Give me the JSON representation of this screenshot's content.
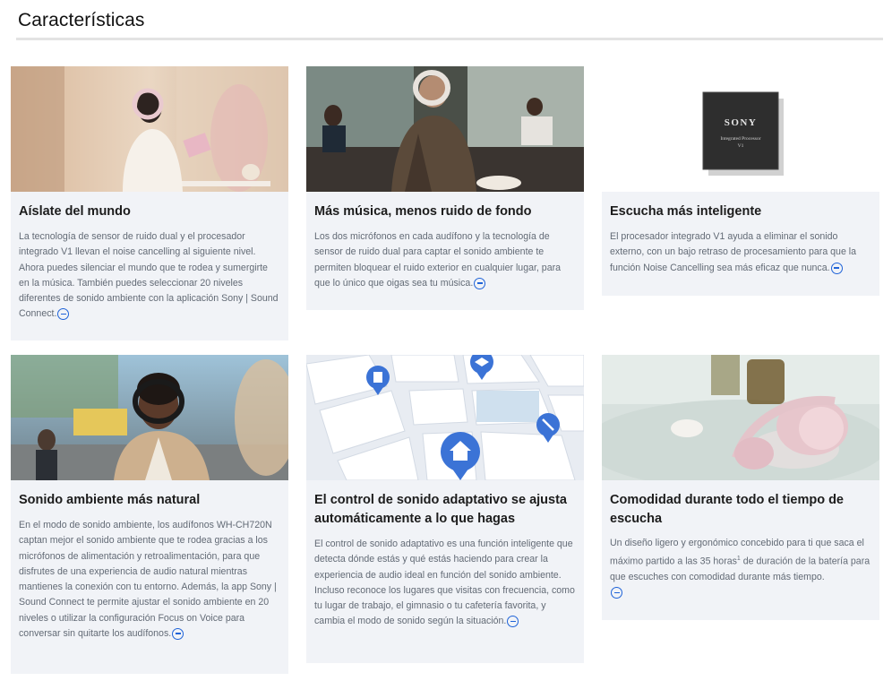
{
  "section": {
    "title": "Características"
  },
  "cards": [
    {
      "title": "Aíslate del mundo",
      "text": "La tecnología de sensor de ruido dual y el procesador integrado V1 llevan el noise cancelling al siguiente nivel. Ahora puedes silenciar el mundo que te rodea y sumergirte en la música. También puedes seleccionar 20 niveles diferentes de sonido ambiente con la aplicación Sony | Sound Connect.",
      "image": "woman-reading-with-headphones"
    },
    {
      "title": "Más música, menos ruido de fondo",
      "text": "Los dos micrófonos en cada audífono y la tecnología de sensor de ruido dual para captar el sonido ambiente te permiten bloquear el ruido exterior en cualquier lugar, para que lo único que oigas sea tu música.",
      "image": "man-in-cafe-with-headphones"
    },
    {
      "title": "Escucha más inteligente",
      "text": "El procesador integrado V1 ayuda a eliminar el sonido externo, con un bajo retraso de procesamiento para que la función Noise Cancelling sea más eficaz que nunca.",
      "image": "processor-chip",
      "chip": {
        "brand": "SONY",
        "line1": "Integrated Processor",
        "line2": "V1"
      }
    },
    {
      "title": "Sonido ambiente más natural",
      "text": "En el modo de sonido ambiente, los audífonos WH-CH720N captan mejor el sonido ambiente que te rodea gracias a los micrófonos de alimentación y retroalimentación, para que disfrutes de una experiencia de audio natural mientras mantienes la conexión con tu entorno. Además, la app Sony | Sound Connect te permite ajustar el sonido ambiente en 20 niveles o utilizar la configuración Focus on Voice para conversar sin quitarte los audífonos.",
      "image": "man-on-street-with-headphones"
    },
    {
      "title": "El control de sonido adaptativo se ajusta automáticamente a lo que hagas",
      "text": "El control de sonido adaptativo es una función inteligente que detecta dónde estás y qué estás haciendo para crear la experiencia de audio ideal en función del sonido ambiente. Incluso reconoce los lugares que visitas con frecuencia, como tu lugar de trabajo, el gimnasio o tu cafetería favorita, y cambia el modo de sonido según la situación.",
      "image": "map-with-location-pins"
    },
    {
      "title": "Comodidad durante todo el tiempo de escucha",
      "text_before_sup": "Un diseño ligero y ergonómico concebido para ti que saca el máximo partido a las 35 horas",
      "sup": "1",
      "text_after_sup": " de duración de la batería para que escuches con comodidad durante más tiempo.",
      "image": "pink-headphones-on-table"
    }
  ],
  "icons": {
    "collapse": "minus-circle-icon"
  },
  "colors": {
    "accent": "#1f63d8",
    "card_bg": "#f1f3f7",
    "body_text": "#626a75"
  }
}
